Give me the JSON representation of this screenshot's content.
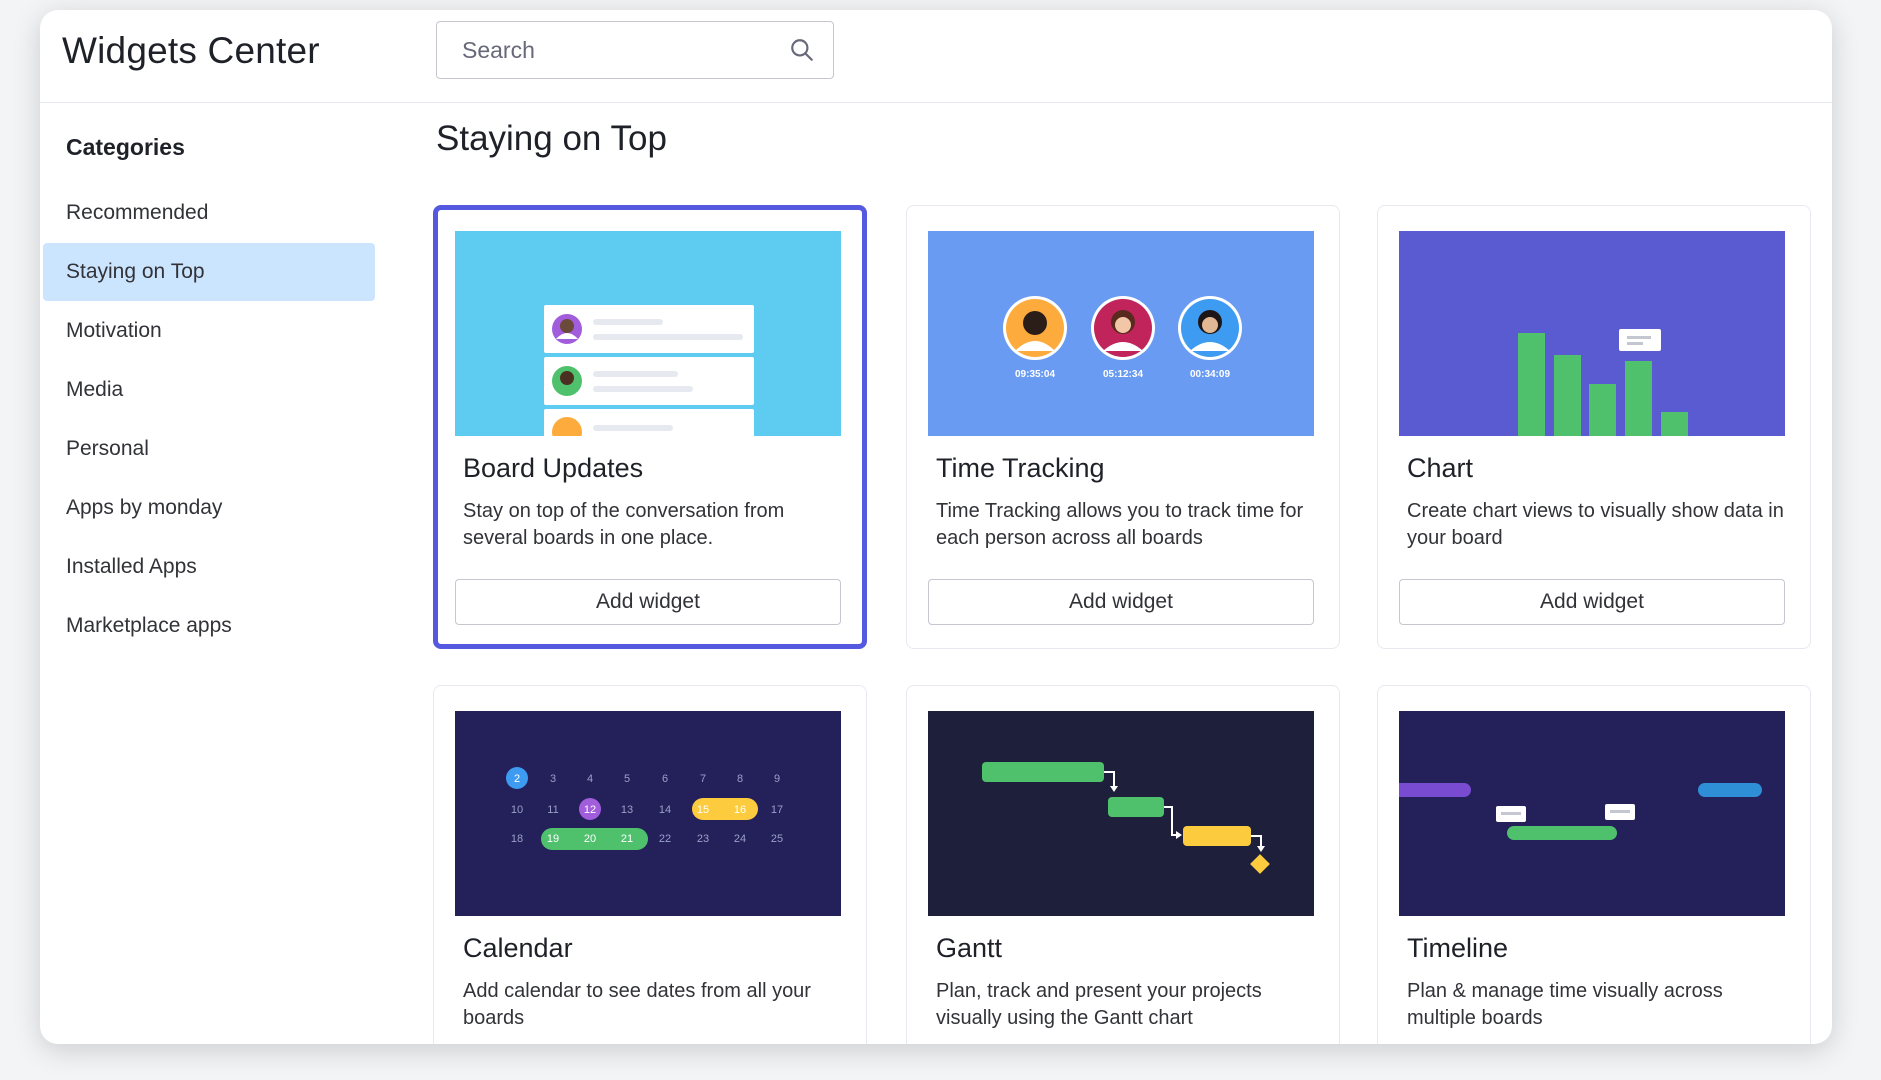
{
  "app": {
    "title": "Widgets Center"
  },
  "search": {
    "placeholder": "Search"
  },
  "sidebar": {
    "heading": "Categories",
    "items": [
      {
        "label": "Recommended"
      },
      {
        "label": "Staying on Top"
      },
      {
        "label": "Motivation"
      },
      {
        "label": "Media"
      },
      {
        "label": "Personal"
      },
      {
        "label": "Apps by monday"
      },
      {
        "label": "Installed Apps"
      },
      {
        "label": "Marketplace apps"
      }
    ]
  },
  "section": {
    "title": "Staying on Top"
  },
  "widgets": [
    {
      "name": "Board Updates",
      "description": "Stay on top of the conversation from several boards in one place.",
      "button": "Add widget",
      "thumb_color": "#5ecbf0"
    },
    {
      "name": "Time Tracking",
      "description": "Time Tracking allows you to track time for each person across all boards",
      "button": "Add widget",
      "thumb_color": "#6a9bf2",
      "timers": [
        "09:35:04",
        "05:12:34",
        "00:34:09"
      ]
    },
    {
      "name": "Chart",
      "description": "Create chart views to visually show data in your board",
      "button": "Add widget",
      "thumb_color": "#5b5bd1"
    },
    {
      "name": "Calendar",
      "description": "Add calendar to see dates from all your boards",
      "thumb_color": "#24205a",
      "calendar_rows": [
        [
          "2",
          "3",
          "4",
          "5",
          "6",
          "7",
          "8",
          "9"
        ],
        [
          "10",
          "11",
          "12",
          "13",
          "14",
          "15",
          "16",
          "17"
        ],
        [
          "18",
          "19",
          "20",
          "21",
          "22",
          "23",
          "24",
          "25"
        ]
      ]
    },
    {
      "name": "Gantt",
      "description": "Plan, track and present your projects visually using the Gantt chart",
      "thumb_color": "#1e1f3b"
    },
    {
      "name": "Timeline",
      "description": "Plan & manage time visually across multiple boards",
      "thumb_color": "#24205a"
    }
  ],
  "colors": {
    "accent": "#5559df",
    "active_bg": "#cce5ff",
    "green": "#4fc16d",
    "yellow": "#fdcb3e",
    "purple": "#a25ddc",
    "blue": "#3d9bf2"
  }
}
